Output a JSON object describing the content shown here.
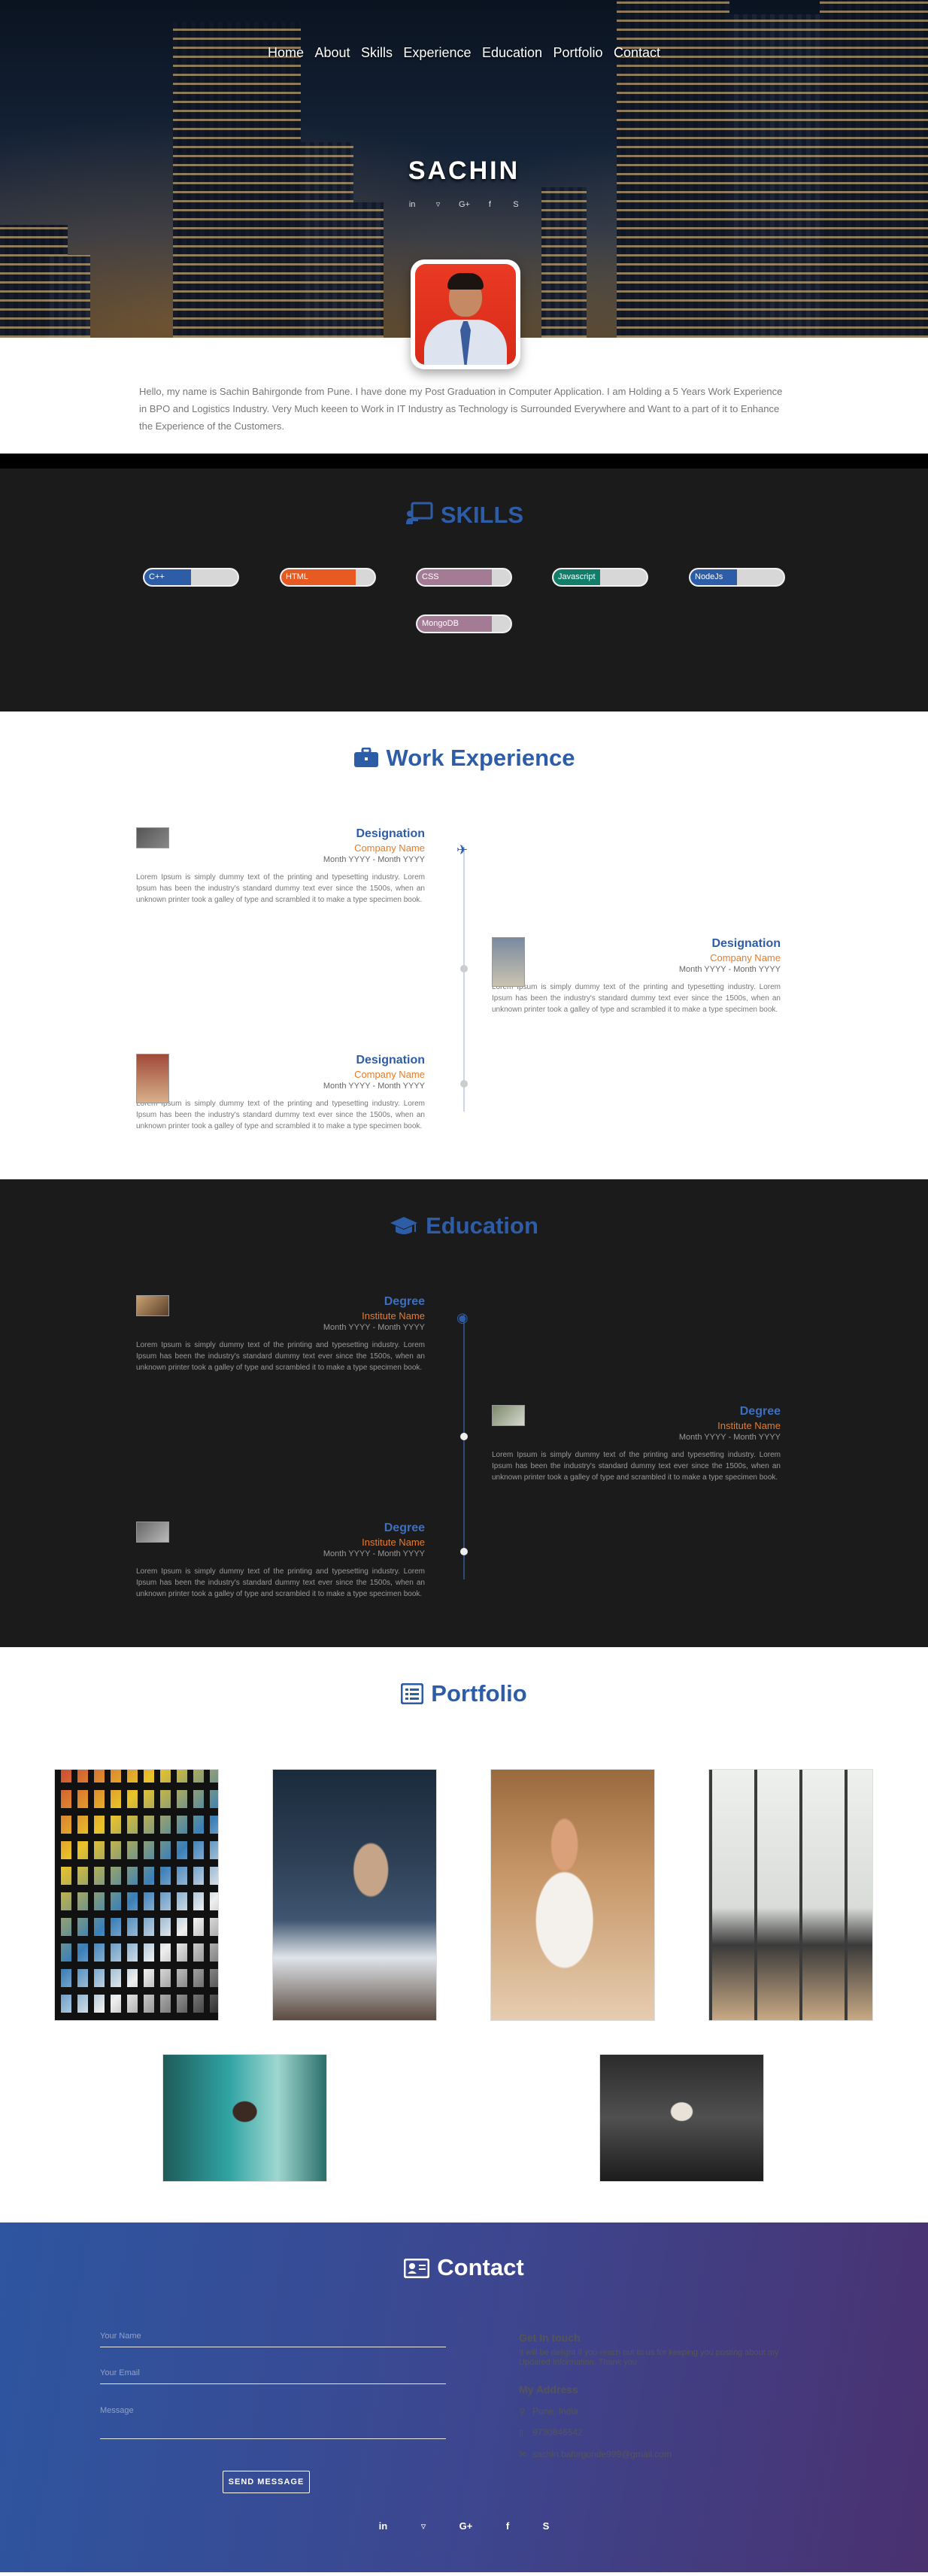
{
  "nav": {
    "items": [
      "Home",
      "About",
      "Skills",
      "Experience",
      "Education",
      "Portfolio",
      "Contact"
    ]
  },
  "hero": {
    "name": "SACHIN",
    "social_icons": [
      "linkedin-icon",
      "tie-icon",
      "google-plus-icon",
      "facebook-icon",
      "skype-icon"
    ]
  },
  "about": {
    "text": "Hello, my name is Sachin Bahirgonde from Pune. I have done my Post Graduation in Computer Application. I am Holding a 5 Years Work Experience in BPO and Logistics Industry. Very Much keeen to Work in IT Industry as Technology is Surrounded Everywhere and Want to a part of it to Enhance the Experience of the Customers."
  },
  "skills": {
    "title": "SKILLS",
    "items": [
      {
        "label": "C++",
        "level": 0.5,
        "color": "#2e5da8"
      },
      {
        "label": "HTML",
        "level": 0.8,
        "color": "#e75a22"
      },
      {
        "label": "CSS",
        "level": 0.8,
        "color": "#a47b95"
      },
      {
        "label": "Javascript",
        "level": 0.5,
        "color": "#127e6a"
      },
      {
        "label": "NodeJs",
        "level": 0.5,
        "color": "#2e5da8"
      },
      {
        "label": "MongoDB",
        "level": 0.8,
        "color": "#a47b95"
      }
    ]
  },
  "experience": {
    "title": "Work Experience",
    "entries": [
      {
        "title": "Designation",
        "subtitle": "Company Name",
        "date": "Month YYYY - Month YYYY",
        "desc": "Lorem Ipsum is simply dummy text of the printing and typesetting industry. Lorem Ipsum has been the industry's standard dummy text ever since the 1500s, when an unknown printer took a galley of type and scrambled it to make a type specimen book."
      },
      {
        "title": "Designation",
        "subtitle": "Company Name",
        "date": "Month YYYY - Month YYYY",
        "desc": "Lorem Ipsum is simply dummy text of the printing and typesetting industry. Lorem Ipsum has been the industry's standard dummy text ever since the 1500s, when an unknown printer took a galley of type and scrambled it to make a type specimen book."
      },
      {
        "title": "Designation",
        "subtitle": "Company Name",
        "date": "Month YYYY - Month YYYY",
        "desc": "Lorem Ipsum is simply dummy text of the printing and typesetting industry. Lorem Ipsum has been the industry's standard dummy text ever since the 1500s, when an unknown printer took a galley of type and scrambled it to make a type specimen book."
      }
    ]
  },
  "education": {
    "title": "Education",
    "entries": [
      {
        "title": "Degree",
        "subtitle": "Institute Name",
        "date": "Month YYYY - Month YYYY",
        "desc": "Lorem Ipsum is simply dummy text of the printing and typesetting industry. Lorem Ipsum has been the industry's standard dummy text ever since the 1500s, when an unknown printer took a galley of type and scrambled it to make a type specimen book."
      },
      {
        "title": "Degree",
        "subtitle": "Institute Name",
        "date": "Month YYYY - Month YYYY",
        "desc": "Lorem Ipsum is simply dummy text of the printing and typesetting industry. Lorem Ipsum has been the industry's standard dummy text ever since the 1500s, when an unknown printer took a galley of type and scrambled it to make a type specimen book."
      },
      {
        "title": "Degree",
        "subtitle": "Institute Name",
        "date": "Month YYYY - Month YYYY",
        "desc": "Lorem Ipsum is simply dummy text of the printing and typesetting industry. Lorem Ipsum has been the industry's standard dummy text ever since the 1500s, when an unknown printer took a galley of type and scrambled it to make a type specimen book."
      }
    ]
  },
  "portfolio": {
    "title": "Portfolio"
  },
  "contact": {
    "title": "Contact",
    "form": {
      "name_placeholder": "Your Name",
      "email_placeholder": "Your Email",
      "message_placeholder": "Message",
      "send_label": "SEND MESSAGE"
    },
    "info": {
      "heading": "Get In touch",
      "text": "It will be delight if you reach out to us for keeping you posting about my Updated Information. Thank you",
      "address_heading": "My Address",
      "location": "Pune, India",
      "phone": "9730846542",
      "email": "sachin.bahirgonde999@gmail.com"
    },
    "social_icons": [
      "linkedin-icon",
      "tie-icon",
      "google-plus-icon",
      "facebook-icon",
      "skype-icon"
    ]
  },
  "colors": {
    "accent": "#2e5da8",
    "orange": "#e67c2b",
    "dark_section": "#1b1b1b"
  }
}
